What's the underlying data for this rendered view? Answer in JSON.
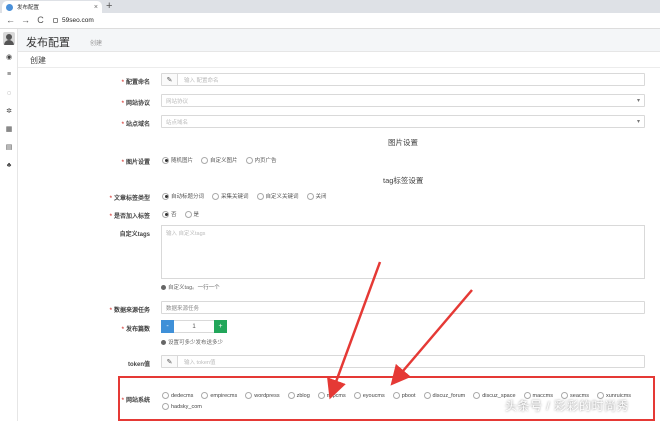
{
  "browser": {
    "tab_title": "发布配置",
    "tab_close": "×",
    "new_tab": "+",
    "back": "←",
    "forward": "→",
    "reload": "C",
    "url": "59seo.com"
  },
  "sidebar": {
    "icons": [
      "home-icon",
      "list-icon",
      "circle-icon",
      "gear-icon",
      "calendar-icon",
      "menu-icon",
      "sitemap-icon"
    ],
    "glyphs": [
      "◉",
      "≡",
      "◌",
      "✲",
      "▦",
      "▤",
      "♣"
    ]
  },
  "header": {
    "title": "发布配置",
    "subtitle": "创建"
  },
  "section": {
    "title": "创建"
  },
  "form": {
    "config_name": {
      "label": "配置命名",
      "placeholder": "输入 配置命名",
      "addon": "✎"
    },
    "site_protocol": {
      "label": "网站协议",
      "placeholder": "网站协议",
      "arrow": "▾"
    },
    "site_domain": {
      "label": "站点域名",
      "placeholder": "站点域名",
      "arrow": "▾"
    },
    "image_heading": "图片设置",
    "image_settings": {
      "label": "图片设置",
      "options": [
        "随机图片",
        "自定义图片",
        "内页广告"
      ],
      "selected": 0
    },
    "tag_heading": "tag标签设置",
    "article_tag_type": {
      "label": "文章标签类型",
      "options": [
        "自动标题分词",
        "采集关键词",
        "自定义关键词",
        "关闭"
      ],
      "selected": 0
    },
    "add_tag": {
      "label": "是否加入标签",
      "options": [
        "否",
        "是"
      ],
      "selected": 0
    },
    "custom_tags": {
      "label": "自定义tags",
      "placeholder": "输入 自定义tags",
      "help": "自定义tag。一行一个"
    },
    "data_source": {
      "label": "数据来源任务",
      "placeholder": "数据来源任务"
    },
    "publish_count": {
      "label": "发布篇数",
      "value": "1",
      "minus": "-",
      "plus": "+",
      "help": "设置可多少发布送多少"
    },
    "token": {
      "label": "token值",
      "placeholder": "输入 token值",
      "addon": "✎"
    },
    "website_system": {
      "label": "网站系统",
      "options": [
        "dedecms",
        "empirecms",
        "wordpress",
        "zblog",
        "mipcms",
        "eyoucms",
        "pboot",
        "discuz_forum",
        "discuz_space",
        "maccms",
        "seacms",
        "xunruicms",
        "hadsky_com"
      ],
      "selected": -1
    }
  },
  "watermark": "头条号 / 彩彩的时尚秀",
  "colors": {
    "highlight": "#e53935",
    "minus": "#3f90d8",
    "plus": "#22a65a"
  }
}
